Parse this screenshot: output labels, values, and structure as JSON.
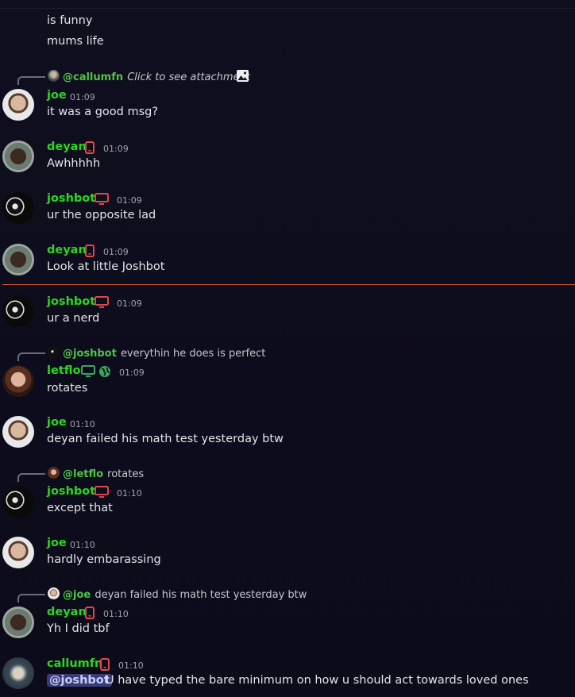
{
  "messages": [
    {
      "text": "is funny"
    },
    {
      "text": "mums life"
    },
    {
      "reply_user": "@callumfn",
      "reply_text": "Click to see attachment",
      "user": "joe",
      "time": "01:09",
      "text": "it was a good msg?"
    },
    {
      "user": "deyan",
      "device": "phone-icon",
      "time": "01:09",
      "text": "Awhhhhh"
    },
    {
      "user": "joshbot",
      "device": "desktop-icon",
      "time": "01:09",
      "text": "ur the opposite lad"
    },
    {
      "user": "deyan",
      "device": "phone-icon",
      "time": "01:09",
      "text": "Look at little Joshbot"
    },
    {
      "user": "joshbot",
      "device": "desktop-icon",
      "time": "01:09",
      "text": "ur a nerd"
    },
    {
      "reply_user": "@joshbot",
      "reply_text": "everythin he does is perfect",
      "user": "letflo",
      "device": "desktop-icon",
      "time": "01:09",
      "text": "rotates"
    },
    {
      "user": "joe",
      "time": "01:10",
      "text": "deyan failed his math test yesterday btw"
    },
    {
      "reply_user": "@letflo",
      "reply_text": "rotates",
      "user": "joshbot",
      "device": "desktop-icon",
      "time": "01:10",
      "text": "except that"
    },
    {
      "user": "joe",
      "time": "01:10",
      "text": "hardly embarassing"
    },
    {
      "reply_user": "@joe",
      "reply_text": "deyan failed his math test yesterday btw",
      "user": "deyan",
      "device": "phone-icon",
      "time": "01:10",
      "text": "Yh I did tbf"
    },
    {
      "user": "callumfn",
      "device": "phone-icon",
      "time": "01:10",
      "mention": "@joshbot",
      "text": "U have typed the bare minimum on how u should act towards loved ones"
    }
  ],
  "colors": {
    "username": "#2bd621",
    "device_icon": "#e0474c",
    "web_icon": "#3ba55c",
    "new_divider": "#d4532a",
    "mention_bg": "#3a3c78"
  }
}
